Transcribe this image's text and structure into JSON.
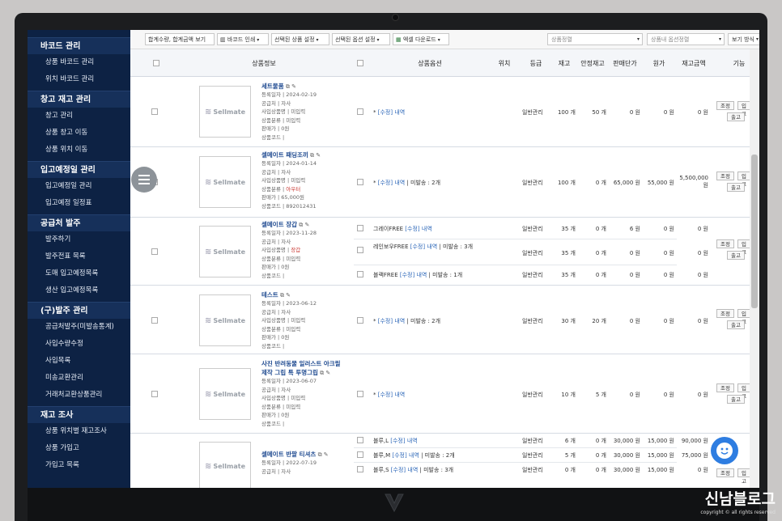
{
  "sidebar": {
    "sections": [
      {
        "title": "바코드 관리",
        "items": [
          "상품 바코드 관리",
          "위치 바코드 관리"
        ]
      },
      {
        "title": "창고 재고 관리",
        "items": [
          "창고 관리",
          "상품 창고 이동",
          "상품 위치 이동"
        ]
      },
      {
        "title": "입고예정일 관리",
        "items": [
          "입고예정일 관리",
          "입고예정 일정표"
        ]
      },
      {
        "title": "공급처 발주",
        "items": [
          "발주하기",
          "발주전표 목록",
          "도매 입고예정목록",
          "생산 입고예정목록"
        ]
      },
      {
        "title": "(구)발주 관리",
        "items": [
          "공급처발주(미발송통계)",
          "사입수량수정",
          "사입목록",
          "미송교환관리",
          "거래처교환상품관리"
        ]
      },
      {
        "title": "재고 조사",
        "items": [
          "상품 위치별 재고조사",
          "상품 가입고",
          "가입고 목록"
        ]
      }
    ]
  },
  "toolbar": {
    "sum_toggle": "합계수량, 합계금액 보기",
    "barcode_print": "바코드 인쇄",
    "selected_product_settings": "선택된 상품 설정",
    "selected_option_settings": "선택된 옵션 설정",
    "excel_download": "엑셀 다운로드",
    "product_sort_placeholder": "상품정렬",
    "option_sort_placeholder": "상품내 옵션정렬",
    "view_mode": "보기 방식"
  },
  "table": {
    "headers": {
      "product_info": "상품정보",
      "product_option": "상품옵션",
      "location": "위치",
      "grade": "등급",
      "stock": "재고",
      "safety_stock": "안정재고",
      "sale_price": "판매단가",
      "cost": "원가",
      "stock_amount": "재고금액",
      "function": "기능"
    },
    "thumb_label": "Sellmate",
    "meta_labels": {
      "reg_date": "등록일자",
      "supplier": "공급처",
      "purchase_name": "사입상품명",
      "category": "상품분류",
      "price": "판매가",
      "code": "상품코드"
    },
    "buttons": {
      "adjust": "조정",
      "inbound": "입고",
      "outbound": "출고"
    },
    "products": [
      {
        "name": "세트물품",
        "reg_date": "2024-02-19",
        "supplier": "자사",
        "purchase_name": "미입력",
        "category": "미입력",
        "price": "0원",
        "code": "",
        "options": [
          {
            "label": "*",
            "edit": "[수정]",
            "history": "내역",
            "unshipped": "",
            "grade": "일반관리",
            "stock": "100 개",
            "safety": "50 개",
            "sale": "0 원",
            "cost": "0 원",
            "amount": "0 원"
          }
        ]
      },
      {
        "name": "셀메이트 패딩조끼",
        "reg_date": "2024-01-14",
        "supplier": "자사",
        "purchase_name": "미입력",
        "category": "아우터",
        "price": "65,000원",
        "code": "892012431",
        "options": [
          {
            "label": "*",
            "edit": "[수정]",
            "history": "내역",
            "unshipped": "미발송 : 2개",
            "grade": "일반관리",
            "stock": "100 개",
            "safety": "0 개",
            "sale": "65,000 원",
            "cost": "55,000 원",
            "amount": "5,500,000 원"
          }
        ]
      },
      {
        "name": "셀메이트 장갑",
        "reg_date": "2023-11-28",
        "supplier": "자사",
        "purchase_name": "장갑",
        "category": "미입력",
        "price": "0원",
        "code": "",
        "options": [
          {
            "label": "그레이FREE",
            "edit": "[수정]",
            "history": "내역",
            "unshipped": "",
            "grade": "일반관리",
            "stock": "35 개",
            "safety": "0 개",
            "sale": "6 원",
            "cost": "0 원",
            "amount": "0 원"
          },
          {
            "label": "레인보우FREE",
            "edit": "[수정]",
            "history": "내역",
            "unshipped": "미발송 : 3개",
            "grade": "일반관리",
            "stock": "35 개",
            "safety": "0 개",
            "sale": "0 원",
            "cost": "0 원",
            "amount": "0 원"
          },
          {
            "label": "블랙FREE",
            "edit": "[수정]",
            "history": "내역",
            "unshipped": "미발송 : 1개",
            "grade": "일반관리",
            "stock": "35 개",
            "safety": "0 개",
            "sale": "0 원",
            "cost": "0 원",
            "amount": "0 원"
          }
        ]
      },
      {
        "name": "테스트",
        "reg_date": "2023-06-12",
        "supplier": "자사",
        "purchase_name": "미입력",
        "category": "미입력",
        "price": "0원",
        "code": "",
        "options": [
          {
            "label": "*",
            "edit": "[수정]",
            "history": "내역",
            "unshipped": "미발송 : 2개",
            "grade": "일반관리",
            "stock": "30 개",
            "safety": "20 개",
            "sale": "0 원",
            "cost": "0 원",
            "amount": "0 원"
          }
        ]
      },
      {
        "name": "사진 반려동물 일러스트 아크릴 제작 그립 톡 투명그립",
        "name_line1": "사진 반려동물 일러스트 아크릴",
        "name_line2": "제작 그립 톡 투명그립",
        "reg_date": "2023-06-07",
        "supplier": "자사",
        "purchase_name": "미입력",
        "category": "미입력",
        "price": "0원",
        "code": "",
        "options": [
          {
            "label": "*",
            "edit": "[수정]",
            "history": "내역",
            "unshipped": "",
            "grade": "일반관리",
            "stock": "10 개",
            "safety": "5 개",
            "sale": "0 원",
            "cost": "0 원",
            "amount": "0 원"
          }
        ]
      },
      {
        "name": "셀메이트 반팔 티셔츠",
        "reg_date": "2022-07-19",
        "supplier": "자사",
        "options": [
          {
            "label": "블루,L",
            "edit": "[수정]",
            "history": "내역",
            "unshipped": "",
            "grade": "일반관리",
            "stock": "6 개",
            "safety": "0 개",
            "sale": "30,000 원",
            "cost": "15,000 원",
            "amount": "90,000 원"
          },
          {
            "label": "블루,M",
            "edit": "[수정]",
            "history": "내역",
            "unshipped": "미발송 : 2개",
            "grade": "일반관리",
            "stock": "5 개",
            "safety": "0 개",
            "sale": "30,000 원",
            "cost": "15,000 원",
            "amount": "75,000 원"
          },
          {
            "label": "블루,S",
            "edit": "[수정]",
            "history": "내역",
            "unshipped": "미발송 : 3개",
            "grade": "일반관리",
            "stock": "0 개",
            "safety": "0 개",
            "sale": "30,000 원",
            "cost": "15,000 원",
            "amount": "0 원"
          }
        ]
      }
    ]
  },
  "watermark": {
    "title": "신남블로그",
    "subtitle": "copyright © all rights reserved"
  },
  "colors": {
    "sidebar": "#0d2244",
    "sidebar_section": "#16305a",
    "link": "#1f4a90",
    "accent_red": "#c8352f",
    "chat_button": "#2e7de1"
  }
}
